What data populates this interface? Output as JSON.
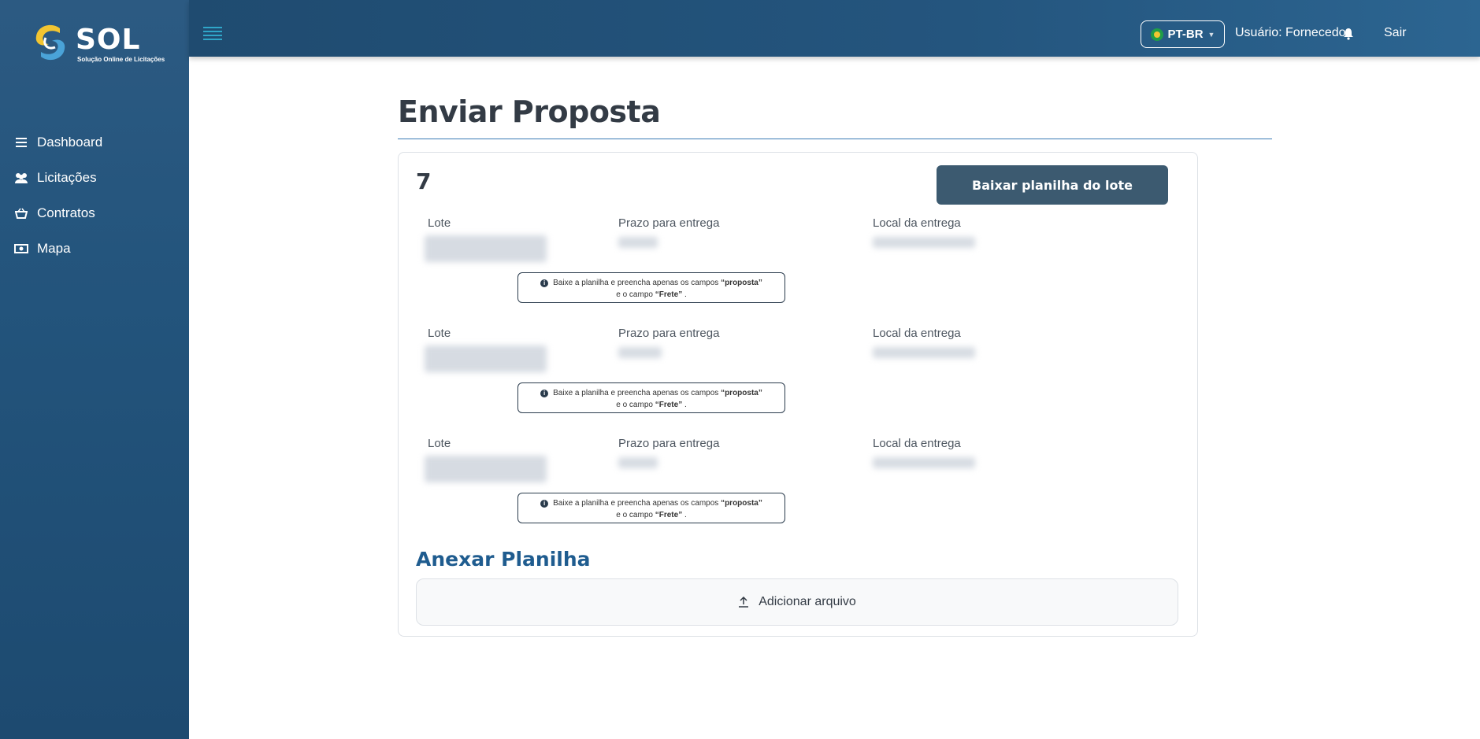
{
  "app": {
    "logo_text": "SOL",
    "logo_subtitle": "Solução Online de Licitações"
  },
  "sidebar": {
    "items": [
      {
        "label": "Dashboard",
        "icon": "list-icon"
      },
      {
        "label": "Licitações",
        "icon": "users-icon"
      },
      {
        "label": "Contratos",
        "icon": "basket-icon"
      },
      {
        "label": "Mapa",
        "icon": "money-icon"
      }
    ]
  },
  "topbar": {
    "language": "PT-BR",
    "user": "Usuário: Fornecedor",
    "logout": "Sair"
  },
  "page": {
    "title": "Enviar Proposta",
    "lot_number": "7",
    "download_button": "Baixar planilha do lote"
  },
  "columns": {
    "lote": "Lote",
    "prazo": "Prazo para entrega",
    "local": "Local da entrega"
  },
  "info": {
    "line1_prefix": "Baixe a planilha e preencha apenas os campos",
    "line1_bold": "“proposta”",
    "line2_prefix": "e o campo",
    "line2_bold": "“Frete”",
    "line2_suffix": "."
  },
  "attach": {
    "title": "Anexar Planilha",
    "button": "Adicionar arquivo"
  }
}
